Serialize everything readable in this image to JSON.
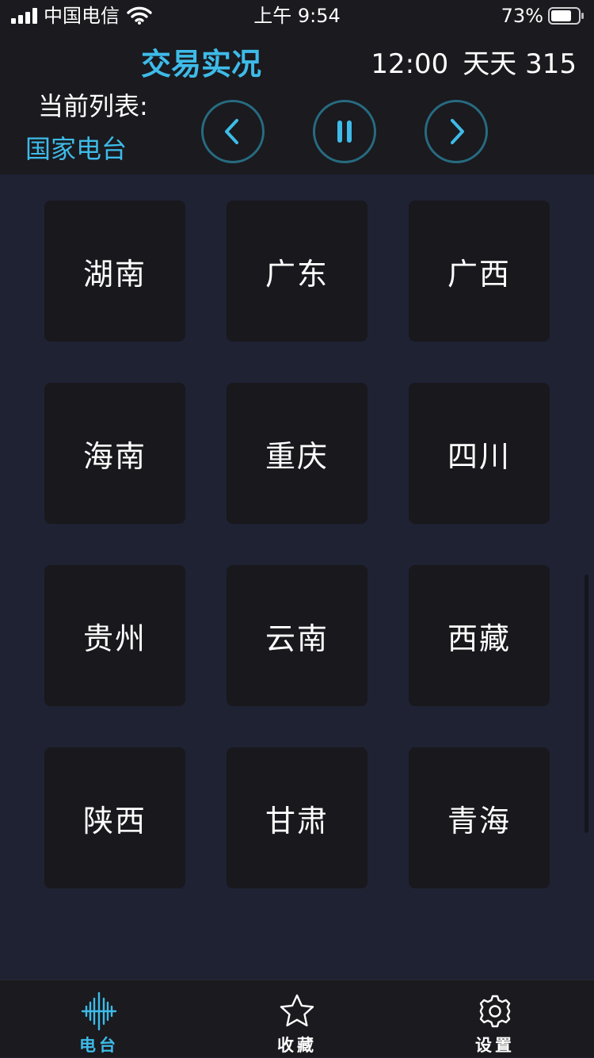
{
  "status_bar": {
    "carrier": "中国电信",
    "time": "上午 9:54",
    "battery": "73%"
  },
  "header": {
    "title": "交易实况",
    "program_time": "12:00",
    "program_name": "天天 315",
    "list_label": "当前列表:",
    "list_name": "国家电台"
  },
  "controls": {
    "prev_icon": "chevron-left-icon",
    "pause_icon": "pause-icon",
    "next_icon": "chevron-right-icon"
  },
  "provinces": [
    "湖南",
    "广东",
    "广西",
    "海南",
    "重庆",
    "四川",
    "贵州",
    "云南",
    "西藏",
    "陕西",
    "甘肃",
    "青海"
  ],
  "tabs": [
    {
      "label": "电台",
      "icon": "waveform-icon",
      "active": true
    },
    {
      "label": "收藏",
      "icon": "star-icon",
      "active": false
    },
    {
      "label": "设置",
      "icon": "gear-icon",
      "active": false
    }
  ],
  "colors": {
    "accent": "#3ebbe8",
    "header_bg": "#1a1a1f",
    "content_bg": "#1f2233",
    "tile_bg": "#18181d",
    "control_ring": "#276b80"
  }
}
